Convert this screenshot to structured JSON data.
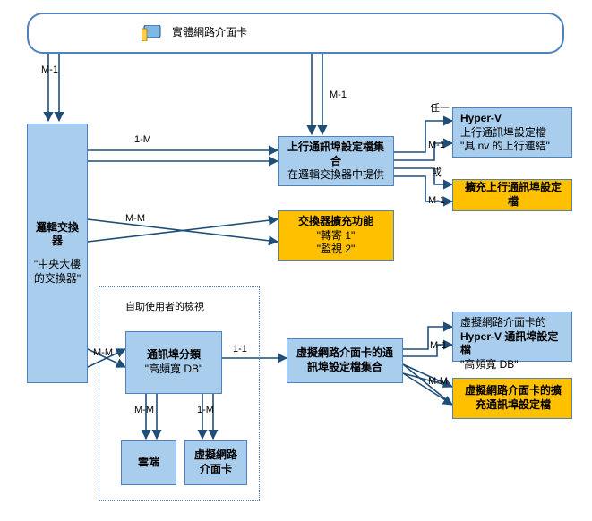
{
  "chart_data": {
    "type": "diagram",
    "title": "",
    "nodes": [
      {
        "id": "physicalNIC",
        "label": "實體網路介面卡",
        "style": "white-rounded",
        "icon": "nic-card-icon"
      },
      {
        "id": "logicalSwitch",
        "title": "邏輯交換器",
        "sub": "\"中央大樓的交換器\"",
        "style": "blue"
      },
      {
        "id": "uplinkProfileSet",
        "title": "上行通訊埠設定檔集合",
        "sub": "在邏輯交換器中提供",
        "style": "blue"
      },
      {
        "id": "switchExt",
        "title": "交換器擴充功能",
        "line2": "\"轉寄 1\"",
        "line3": "\"監視 2\"",
        "style": "orange"
      },
      {
        "id": "hypervUplink",
        "title": "Hyper-V",
        "line2": "上行通訊埠設定檔",
        "line3": "\"具 nv 的上行連結\"",
        "style": "blue"
      },
      {
        "id": "extUplink",
        "title": "擴充上行通訊埠設定檔",
        "style": "orange"
      },
      {
        "id": "selfServiceGroup",
        "title": "自助使用者的檢視",
        "style": "group"
      },
      {
        "id": "portClass",
        "title": "通訊埠分類",
        "sub": "\"高頻寬 DB\"",
        "style": "blue"
      },
      {
        "id": "cloud",
        "title": "雲端",
        "style": "blue"
      },
      {
        "id": "vnic",
        "title": "虛擬網路介面卡",
        "style": "blue"
      },
      {
        "id": "vnicPortProfileSet",
        "title": "虛擬網路介面卡的通訊埠設定檔集合",
        "style": "blue"
      },
      {
        "id": "vnicHyperV",
        "line1": "虛擬網路介面卡的",
        "line2": "Hyper-V 通訊埠設定檔",
        "line3": "\"高頻寬 DB\"",
        "style": "blue"
      },
      {
        "id": "vnicExt",
        "title": "虛擬網路介面卡的擴充通訊埠設定檔",
        "style": "orange"
      }
    ],
    "edges": [
      {
        "from": "physicalNIC",
        "to": "logicalSwitch",
        "label": "M-1"
      },
      {
        "from": "physicalNIC",
        "to": "uplinkProfileSet",
        "label": "M-1"
      },
      {
        "from": "logicalSwitch",
        "to": "uplinkProfileSet",
        "label": "1-M"
      },
      {
        "from": "logicalSwitch",
        "to": "switchExt",
        "label": "M-M"
      },
      {
        "from": "logicalSwitch",
        "to": "portClass",
        "label": "M-M"
      },
      {
        "from": "uplinkProfileSet",
        "to": "hypervUplink",
        "label": "M-1",
        "note": "任一"
      },
      {
        "from": "uplinkProfileSet",
        "to": "extUplink",
        "label": "M-1",
        "note": "或"
      },
      {
        "from": "portClass",
        "to": "cloud",
        "label": "M-M"
      },
      {
        "from": "portClass",
        "to": "vnic",
        "label": "1-M"
      },
      {
        "from": "portClass",
        "to": "vnicPortProfileSet",
        "label": "1-1"
      },
      {
        "from": "vnicPortProfileSet",
        "to": "vnicHyperV",
        "label": "M-1"
      },
      {
        "from": "vnicPortProfileSet",
        "to": "vnicExt",
        "label": "M-M"
      }
    ],
    "edgeLabels": {
      "M1": "M-1",
      "M1b": "M-1",
      "oneM": "1-M",
      "MM": "M-M",
      "MMa": "M-M",
      "any": "任一",
      "or": "或",
      "M1c": "M-1",
      "M1d": "M-1",
      "MMb": "M-M",
      "oneMb": "1-M",
      "oneOne": "1-1",
      "M1e": "M-1",
      "MMc": "M-M"
    }
  }
}
